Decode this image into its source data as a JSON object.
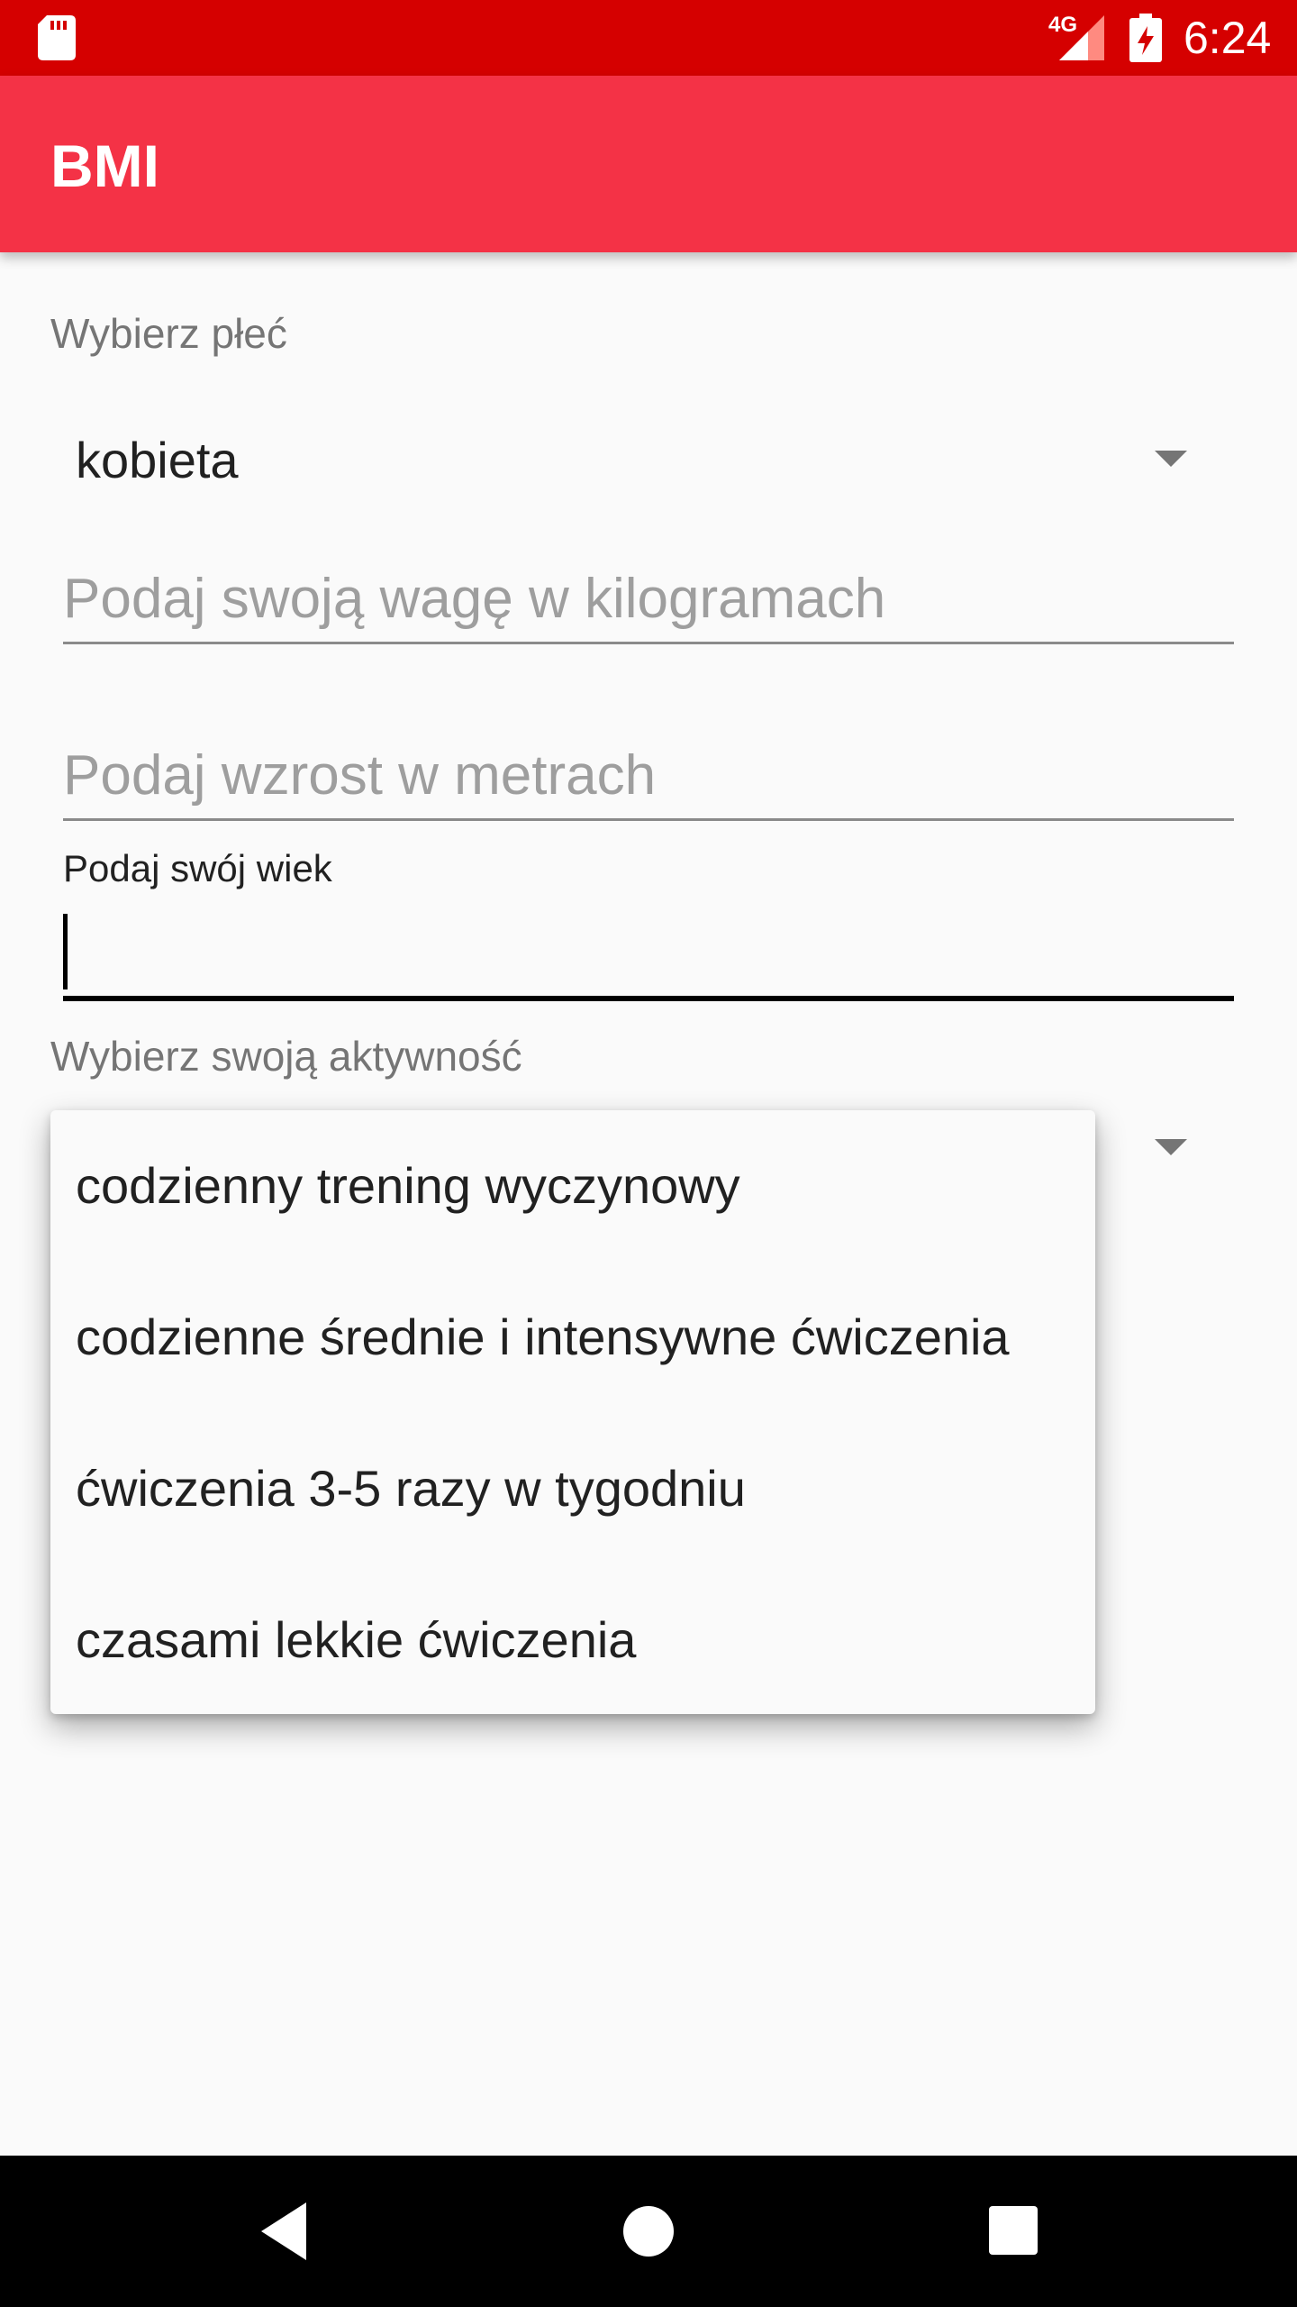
{
  "status_bar": {
    "network_type": "4G",
    "time": "6:24",
    "icons": [
      "sd-card-icon",
      "signal-icon",
      "battery-charging-icon"
    ]
  },
  "app_bar": {
    "title": "BMI"
  },
  "form": {
    "gender_label": "Wybierz płeć",
    "gender_value": "kobieta",
    "weight_placeholder": "Podaj swoją wagę w kilogramach",
    "weight_value": "",
    "height_placeholder": "Podaj wzrost w metrach",
    "height_value": "",
    "age_label": "Podaj swój wiek",
    "age_value": "",
    "activity_label": "Wybierz swoją aktywność"
  },
  "activity_options": [
    "codzienny trening wyczynowy",
    "codzienne średnie i intensywne ćwiczenia",
    "ćwiczenia 3-5 razy w tygodniu",
    "czasami lekkie ćwiczenia"
  ],
  "nav_bar": {
    "icons": [
      "back-icon",
      "home-icon",
      "recents-icon"
    ]
  },
  "colors": {
    "status_bar": "#d50000",
    "app_bar": "#f43246",
    "background": "#fafafa",
    "hint_text": "#9e9e9e"
  }
}
